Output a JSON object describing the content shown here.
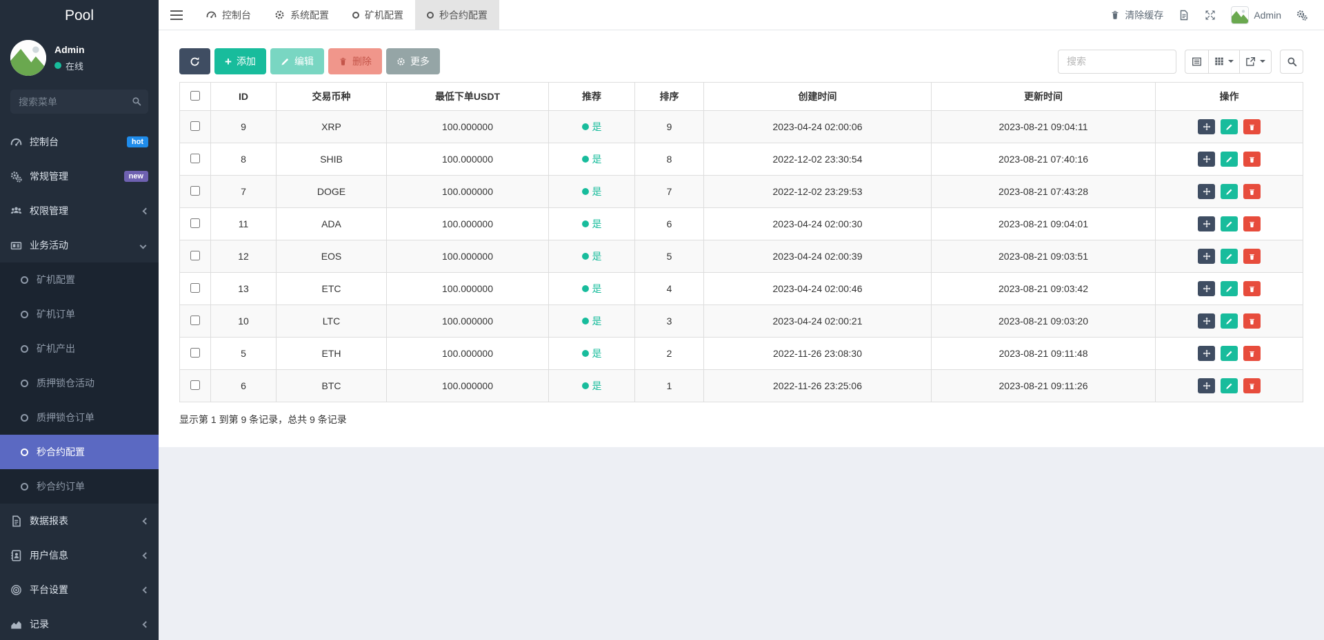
{
  "sidebar": {
    "brand": "Pool",
    "user": {
      "name": "Admin",
      "status": "在线"
    },
    "search_placeholder": "搜索菜单",
    "menu": {
      "top": [
        {
          "label": "控制台",
          "badge": "hot"
        },
        {
          "label": "常规管理",
          "badge": "new"
        },
        {
          "label": "权限管理"
        },
        {
          "label": "业务活动"
        }
      ],
      "children": [
        "矿机配置",
        "矿机订单",
        "矿机产出",
        "质押锁仓活动",
        "质押锁仓订单",
        "秒合约配置",
        "秒合约订单"
      ],
      "selected_child": "秒合约配置",
      "bottom": [
        {
          "label": "数据报表"
        },
        {
          "label": "用户信息"
        },
        {
          "label": "平台设置"
        },
        {
          "label": "记录"
        }
      ]
    }
  },
  "topbar": {
    "tabs": [
      {
        "label": "控制台"
      },
      {
        "label": "系统配置"
      },
      {
        "label": "矿机配置"
      },
      {
        "label": "秒合约配置",
        "active": true
      }
    ],
    "clear_cache": "清除缓存",
    "username": "Admin"
  },
  "toolbar": {
    "add": "添加",
    "edit": "编辑",
    "delete": "删除",
    "more": "更多",
    "search_placeholder": "搜索"
  },
  "table": {
    "columns": [
      "ID",
      "交易币种",
      "最低下单USDT",
      "推荐",
      "排序",
      "创建时间",
      "更新时间",
      "操作"
    ],
    "rows": [
      {
        "id": "9",
        "coin": "XRP",
        "min_usdt": "100.000000",
        "recommend": "是",
        "sort": "9",
        "created_at": "2023-04-24 02:00:06",
        "updated_at": "2023-08-21 09:04:11"
      },
      {
        "id": "8",
        "coin": "SHIB",
        "min_usdt": "100.000000",
        "recommend": "是",
        "sort": "8",
        "created_at": "2022-12-02 23:30:54",
        "updated_at": "2023-08-21 07:40:16"
      },
      {
        "id": "7",
        "coin": "DOGE",
        "min_usdt": "100.000000",
        "recommend": "是",
        "sort": "7",
        "created_at": "2022-12-02 23:29:53",
        "updated_at": "2023-08-21 07:43:28"
      },
      {
        "id": "11",
        "coin": "ADA",
        "min_usdt": "100.000000",
        "recommend": "是",
        "sort": "6",
        "created_at": "2023-04-24 02:00:30",
        "updated_at": "2023-08-21 09:04:01"
      },
      {
        "id": "12",
        "coin": "EOS",
        "min_usdt": "100.000000",
        "recommend": "是",
        "sort": "5",
        "created_at": "2023-04-24 02:00:39",
        "updated_at": "2023-08-21 09:03:51"
      },
      {
        "id": "13",
        "coin": "ETC",
        "min_usdt": "100.000000",
        "recommend": "是",
        "sort": "4",
        "created_at": "2023-04-24 02:00:46",
        "updated_at": "2023-08-21 09:03:42"
      },
      {
        "id": "10",
        "coin": "LTC",
        "min_usdt": "100.000000",
        "recommend": "是",
        "sort": "3",
        "created_at": "2023-04-24 02:00:21",
        "updated_at": "2023-08-21 09:03:20"
      },
      {
        "id": "5",
        "coin": "ETH",
        "min_usdt": "100.000000",
        "recommend": "是",
        "sort": "2",
        "created_at": "2022-11-26 23:08:30",
        "updated_at": "2023-08-21 09:11:48"
      },
      {
        "id": "6",
        "coin": "BTC",
        "min_usdt": "100.000000",
        "recommend": "是",
        "sort": "1",
        "created_at": "2022-11-26 23:25:06",
        "updated_at": "2023-08-21 09:11:26"
      }
    ],
    "summary": "显示第 1 到第 9 条记录，总共 9 条记录"
  },
  "colors": {
    "sidebar_bg": "#232d3a",
    "submenu_bg": "#1b2430",
    "selected_item": "#5b69c2",
    "success": "#18bc9c",
    "danger": "#e74c3c",
    "dark_button": "#3f4d62",
    "more_button": "#95a5a6",
    "badge_hot": "#1f8ceb",
    "badge_new": "#6e61b1"
  }
}
